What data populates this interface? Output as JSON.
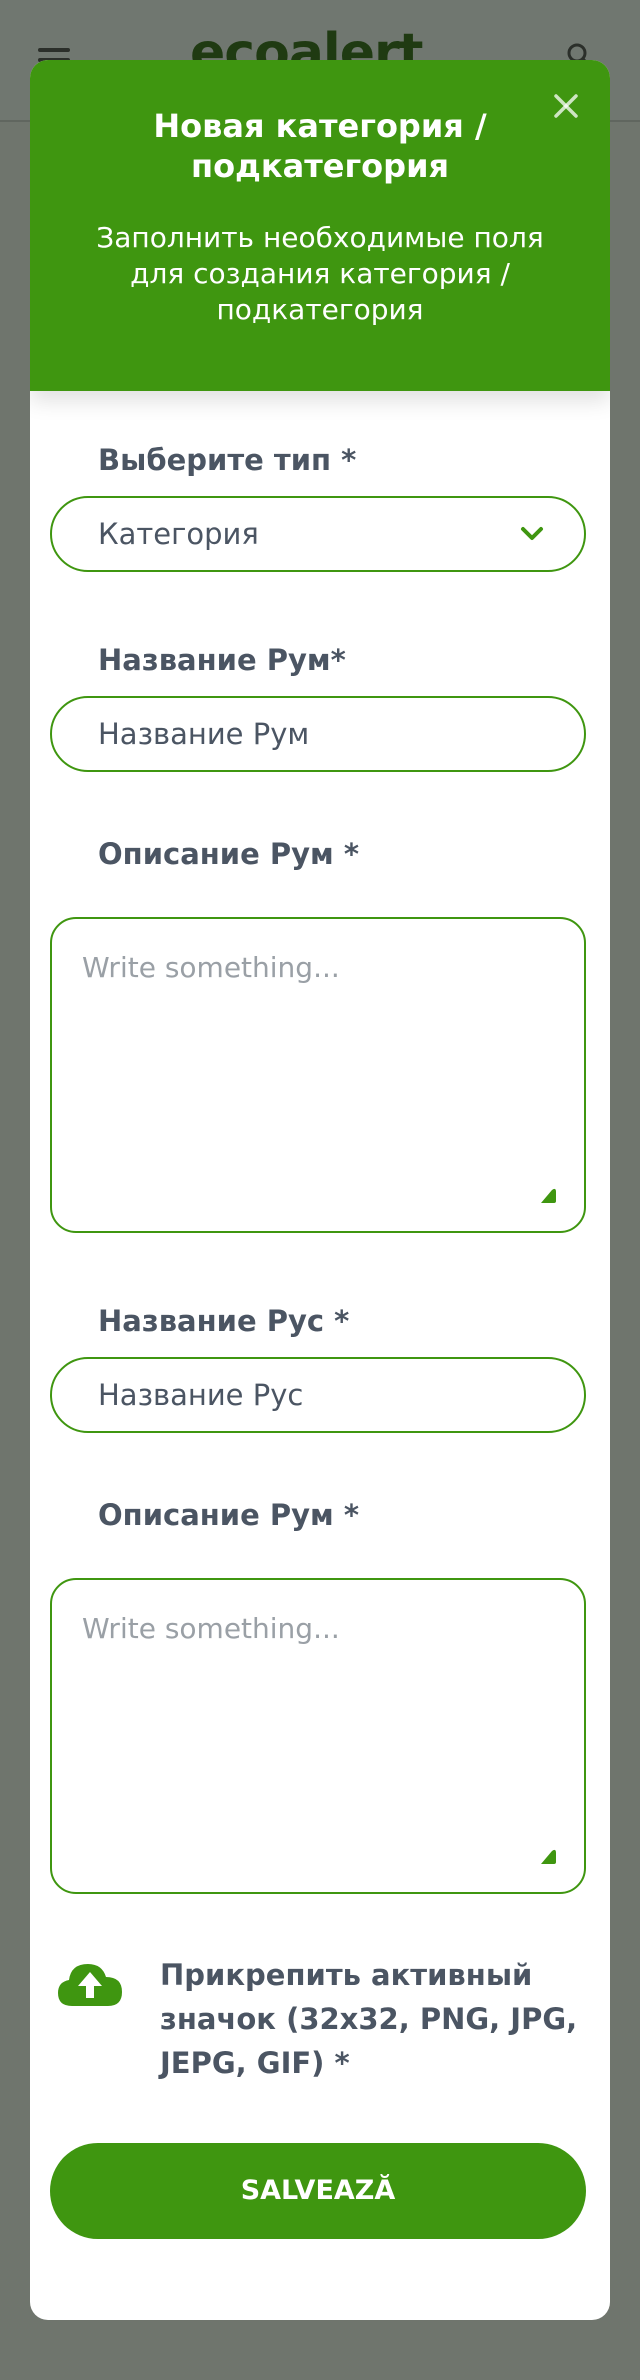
{
  "background": {
    "logo_text": "ecoalert"
  },
  "modal": {
    "title": "Новая категория / подкатегория",
    "subtitle": "Заполнить необходимые поля для создания категория / подкатегория"
  },
  "form": {
    "type_label": "Выберите тип *",
    "type_value": "Категория",
    "name_rum_label": "Название Рум*",
    "name_rum_value": "Название Рум",
    "desc_rum_label": "Описание Рум *",
    "desc_rum_placeholder": "Write something...",
    "name_rus_label": "Название Рус *",
    "name_rus_value": "Название Рус",
    "desc_rus_label": "Описание Рум *",
    "desc_rus_placeholder": "Write something...",
    "upload_label": "Прикрепить активный значок (32x32, PNG, JPG, JEPG, GIF) *",
    "save_label": "SALVEAZĂ"
  },
  "colors": {
    "accent": "#3f9610",
    "overlay": "#6f756d",
    "text": "#4b5563",
    "placeholder": "#9aa0a6"
  }
}
